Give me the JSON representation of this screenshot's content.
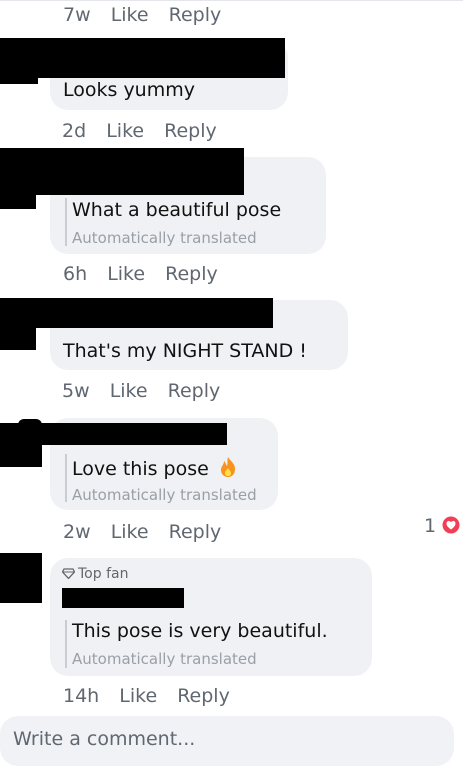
{
  "comments": [
    {
      "text": "",
      "time": "7w",
      "like": "Like",
      "reply": "Reply"
    },
    {
      "text": "Looks yummy",
      "time": "2d",
      "like": "Like",
      "reply": "Reply"
    },
    {
      "text": "What a beautiful pose",
      "translated": "Automatically translated",
      "time": "6h",
      "like": "Like",
      "reply": "Reply"
    },
    {
      "text": "That's my NIGHT STAND !",
      "time": "5w",
      "like": "Like",
      "reply": "Reply"
    },
    {
      "text": "Love this pose",
      "translated": "Automatically translated",
      "time": "2w",
      "like": "Like",
      "reply": "Reply",
      "reaction_count": "1"
    },
    {
      "badge": "Top fan",
      "text": "This pose is very beautiful.",
      "translated": "Automatically translated",
      "time": "14h",
      "like": "Like",
      "reply": "Reply"
    }
  ],
  "composer": {
    "placeholder": "Write a comment..."
  },
  "colors": {
    "reaction": "#f33e58",
    "fire": "#f7931e",
    "bubble": "#eff1f4"
  },
  "icons": {
    "fire": "fire-icon",
    "heart": "heart-reaction-icon",
    "diamond": "top-fan-diamond-icon"
  }
}
